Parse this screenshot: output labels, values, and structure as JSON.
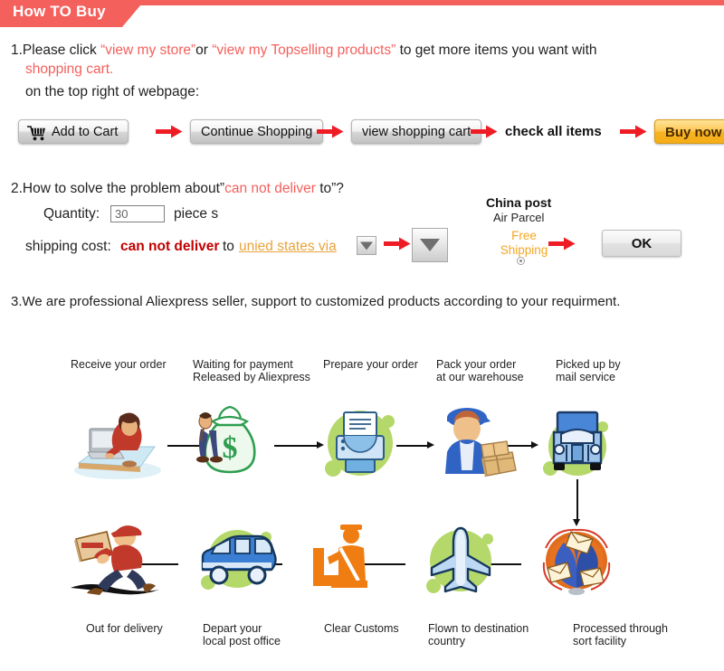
{
  "header": {
    "title": "How TO Buy",
    "accent_color": "#f4605c"
  },
  "section1": {
    "line1_pre": "1.Please click ",
    "line1_link1": "“view my store”",
    "line1_mid": "or ",
    "line1_link2": "“view my Topselling products”",
    "line1_post": " to get more items you want with",
    "line2_link": "shopping cart.",
    "line3": "on the top right of webpage:",
    "buttons": {
      "add_to_cart": "Add to Cart",
      "continue_shopping": "Continue Shopping",
      "view_shopping_cart": "view shopping cart",
      "check_all_items": "check all items",
      "buy_now": "Buy now"
    },
    "cart_icon_name": "shopping-cart-icon"
  },
  "section2": {
    "line1_pre": "2.How to solve the problem about”",
    "line1_red": "can not deliver",
    "line1_post": " to”?",
    "quantity_label": "Quantity:",
    "quantity_value": "30",
    "quantity_placeholder": "30",
    "quantity_unit": "piece s",
    "shipping_label": "shipping cost:",
    "shipping_red": "can not deliver",
    "shipping_to": "to",
    "shipping_country": "unied states via",
    "carrier_title": "China post",
    "carrier_sub": "Air Parcel",
    "free_shipping": "Free Shipping",
    "ok_button": "OK",
    "country_color": "#e8a33d",
    "free_shipping_color": "#f5a623"
  },
  "section3": {
    "line1": "3.We are professional Aliexpress seller, support to customized products according to your requirment."
  },
  "flow": {
    "nodes": [
      {
        "id": "receive-order",
        "label": "Receive your order",
        "icon": "person-at-computer-icon"
      },
      {
        "id": "waiting-payment",
        "label": "Waiting for payment\nReleased by Aliexpress",
        "icon": "money-bag-icon"
      },
      {
        "id": "prepare-order",
        "label": "Prepare your order",
        "icon": "printer-icon"
      },
      {
        "id": "pack-order",
        "label": "Pack your order\nat our warehouse",
        "icon": "worker-with-boxes-icon"
      },
      {
        "id": "picked-up",
        "label": "Picked up by\nmail service",
        "icon": "delivery-truck-icon"
      },
      {
        "id": "sort-facility",
        "label": "Processed through\nsort facility",
        "icon": "mail-pile-icon"
      },
      {
        "id": "flown-destination",
        "label": "Flown to destination\ncountry",
        "icon": "airplane-icon"
      },
      {
        "id": "clear-customs",
        "label": "Clear Customs",
        "icon": "customs-officer-icon"
      },
      {
        "id": "depart-post-office",
        "label": "Depart your\nlocal post office",
        "icon": "delivery-van-icon"
      },
      {
        "id": "out-for-delivery",
        "label": "Out for delivery",
        "icon": "courier-running-icon"
      }
    ]
  }
}
